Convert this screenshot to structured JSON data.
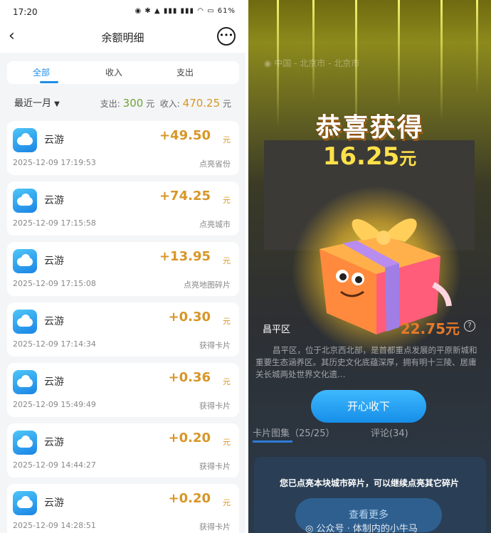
{
  "left": {
    "status": {
      "time": "17:20",
      "battery": "61%"
    },
    "header": {
      "title": "余额明细"
    },
    "tabs": [
      "全部",
      "收入",
      "支出"
    ],
    "filter": {
      "period": "最近一月",
      "expense_label": "支出:",
      "expense_value": "300",
      "income_label": "收入:",
      "income_value": "470.25",
      "unit": "元"
    },
    "records": [
      {
        "app": "云游",
        "amount": "+49.50",
        "unit": "元",
        "time": "2025-12-09 17:19:53",
        "desc": "点亮省份"
      },
      {
        "app": "云游",
        "amount": "+74.25",
        "unit": "元",
        "time": "2025-12-09 17:15:58",
        "desc": "点亮城市"
      },
      {
        "app": "云游",
        "amount": "+13.95",
        "unit": "元",
        "time": "2025-12-09 17:15:08",
        "desc": "点亮地图碎片"
      },
      {
        "app": "云游",
        "amount": "+0.30",
        "unit": "元",
        "time": "2025-12-09 17:14:34",
        "desc": "获得卡片"
      },
      {
        "app": "云游",
        "amount": "+0.36",
        "unit": "元",
        "time": "2025-12-09 15:49:49",
        "desc": "获得卡片"
      },
      {
        "app": "云游",
        "amount": "+0.20",
        "unit": "元",
        "time": "2025-12-09 14:44:27",
        "desc": "获得卡片"
      },
      {
        "app": "云游",
        "amount": "+0.20",
        "unit": "元",
        "time": "2025-12-09 14:28:51",
        "desc": "获得卡片"
      }
    ]
  },
  "right": {
    "location": "中国 - 北京市 - 北京市",
    "congrats": "恭喜获得",
    "reward_amount": "16.25",
    "reward_unit": "元",
    "district": "昌平区",
    "district_value": "22.75元",
    "intro": "昌平区，位于北京西北部，是首都重点发展的平原新城和重要生态涵养区。其历史文化底蕴深厚，拥有明十三陵、居庸关长城两处世界文化遗…",
    "accept_button": "开心收下",
    "tab_cards": "卡片图集（25/25）",
    "tab_comments": "评论(34)",
    "hint": "您已点亮本块城市碎片，可以继续点亮其它碎片",
    "more_button": "查看更多",
    "watermark": "公众号 · 体制内的小牛马"
  }
}
